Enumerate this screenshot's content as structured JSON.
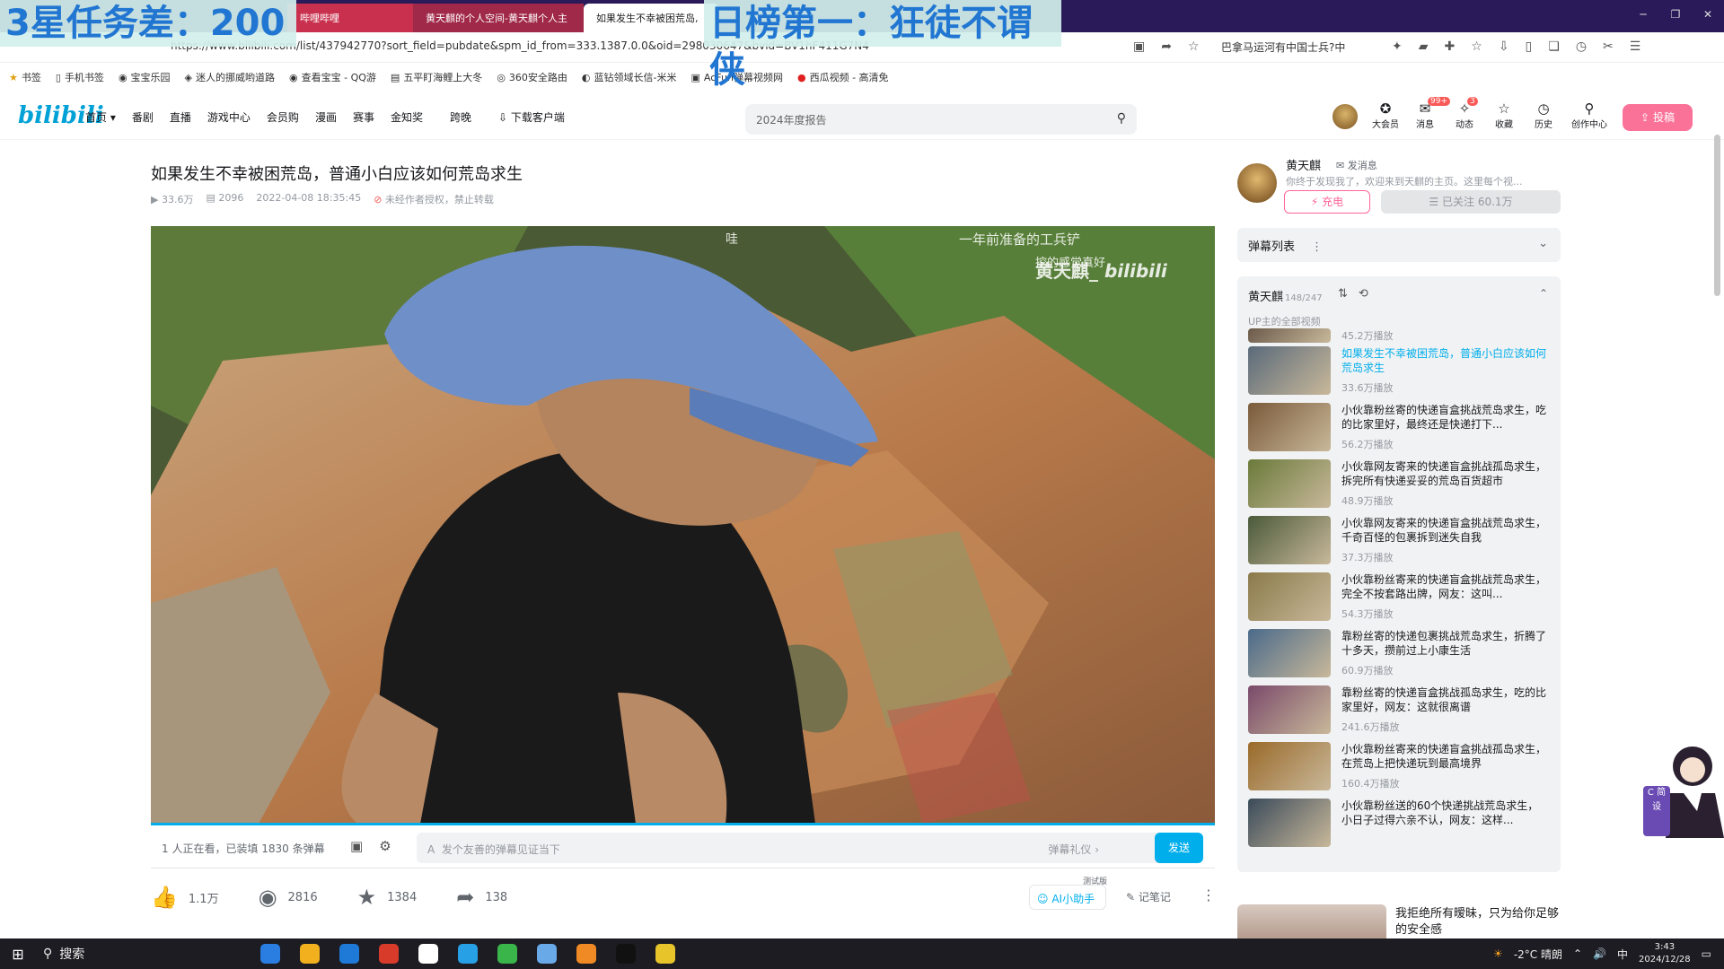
{
  "browser": {
    "tabs": [
      {
        "label": "哔哩哔哩"
      },
      {
        "label": "黄天麒的个人空间-黄天麒个人主"
      },
      {
        "label": "如果发生不幸被困荒岛,"
      }
    ],
    "overlay_left": "3星任务差：200",
    "overlay_right": "日榜第一：狂徒不谓侠",
    "url": "https://www.bilibili.com/list/437942770?sort_field=pubdate&spm_id_from=333.1387.0.0&oid=298030647&bvid=BV1hF411G7N4",
    "search_suggest": "巴拿马运河有中国士兵?中",
    "bookmarks": [
      "书签",
      "手机书签",
      "宝宝乐园",
      "迷人的挪威哟道路",
      "查看宝宝 - QQ游",
      "五平盯海鲤上大冬",
      "360安全路由",
      "蓝钻领域长信-米米",
      "AcFun弹幕视频网",
      "西瓜视频 - 高清免"
    ]
  },
  "header": {
    "logo": "bilibili",
    "nav": [
      "首页",
      "番剧",
      "直播",
      "游戏中心",
      "会员购",
      "漫画",
      "赛事",
      "金知奖",
      "跨晚",
      "下载客户端"
    ],
    "search_placeholder": "2024年度报告",
    "icons": [
      {
        "label": "大会员",
        "glyph": "✪",
        "badge": ""
      },
      {
        "label": "消息",
        "glyph": "✉",
        "badge": "99+"
      },
      {
        "label": "动态",
        "glyph": "✧",
        "badge": "3"
      },
      {
        "label": "收藏",
        "glyph": "☆",
        "badge": ""
      },
      {
        "label": "历史",
        "glyph": "◷",
        "badge": ""
      },
      {
        "label": "创作中心",
        "glyph": "⚲",
        "badge": ""
      }
    ],
    "upload": "投稿"
  },
  "video": {
    "title": "如果发生不幸被困荒岛，普通小白应该如何荒岛求生",
    "views": "33.6万",
    "danmaku_count": "2096",
    "date": "2022-04-08 18:35:45",
    "copyright": "未经作者授权，禁止转载",
    "watermark_text1": "一年前准备的工兵铲",
    "watermark_text2": "黄天麒_",
    "watermark_text3": "挖的感觉真好",
    "watermark_text4": "哇"
  },
  "danmaku_bar": {
    "status": "1 人正在看，已装填 1830 条弹幕",
    "placeholder": "发个友善的弹幕见证当下",
    "etiquette": "弹幕礼仪 ›",
    "send": "发送"
  },
  "actions": {
    "like": "1.1万",
    "coin": "2816",
    "fav": "1384",
    "share": "138",
    "ai_tag": "测试版",
    "ai": "AI小助手",
    "note": "记笔记"
  },
  "up": {
    "name": "黄天麒",
    "msg": "发消息",
    "desc": "你终于发现我了，欢迎来到天麒的主页。这里每个视...",
    "charge": "充电",
    "follow": "已关注 60.1万"
  },
  "danmaku_list": {
    "label": "弹幕列表"
  },
  "playlist": {
    "title": "黄天麒",
    "count": "148/247",
    "subtitle": "UP主的全部视频",
    "items": [
      {
        "title": "",
        "views": "45.2万播放",
        "color": "#6b5a4a"
      },
      {
        "title": "如果发生不幸被困荒岛，普通小白应该如何荒岛求生",
        "views": "33.6万播放",
        "color": "#5a6a7a"
      },
      {
        "title": "小伙靠粉丝寄的快递盲盒挑战荒岛求生，吃的比家里好，最终还是快递打下...",
        "views": "56.2万播放",
        "color": "#7a5a3a"
      },
      {
        "title": "小伙靠网友寄来的快递盲盒挑战孤岛求生，拆完所有快递妥妥的荒岛百货超市",
        "views": "48.9万播放",
        "color": "#6a7a3a"
      },
      {
        "title": "小伙靠网友寄来的快递盲盒挑战荒岛求生，千奇百怪的包裹拆到迷失自我",
        "views": "37.3万播放",
        "color": "#4a5a3a"
      },
      {
        "title": "小伙靠粉丝寄来的快递盲盒挑战荒岛求生，完全不按套路出牌，网友：这叫...",
        "views": "54.3万播放",
        "color": "#8a7a4a"
      },
      {
        "title": "靠粉丝寄的快递包裹挑战荒岛求生，折腾了十多天，攒前过上小康生活",
        "views": "60.9万播放",
        "color": "#4a6a8a"
      },
      {
        "title": "靠粉丝寄的快递盲盒挑战孤岛求生，吃的比家里好，网友：这就很离谱",
        "views": "241.6万播放",
        "color": "#7a4a6a"
      },
      {
        "title": "小伙靠粉丝寄来的快递盲盒挑战孤岛求生，在荒岛上把快递玩到最高境界",
        "views": "160.4万播放",
        "color": "#9a6a2a"
      },
      {
        "title": "小伙靠粉丝送的60个快递挑战荒岛求生，小日子过得六亲不认，网友：这样...",
        "views": "",
        "color": "#3a4a5a"
      }
    ]
  },
  "recommend": {
    "title": "我拒绝所有暧昧，只为给你足够的安全感"
  },
  "mascot_label": "C 简 设",
  "taskbar": {
    "search": "搜索",
    "weather": "-2°C 晴朗",
    "ime": "中",
    "time": "3:43",
    "date": "2024/12/28",
    "app_colors": [
      "#2a7de1",
      "#f2b01e",
      "#1e7ad6",
      "#d93b2b",
      "#fff",
      "#28a0e6",
      "#3ab54a",
      "#6aa9e8",
      "#f08a24",
      "#111",
      "#e6c42a"
    ]
  }
}
